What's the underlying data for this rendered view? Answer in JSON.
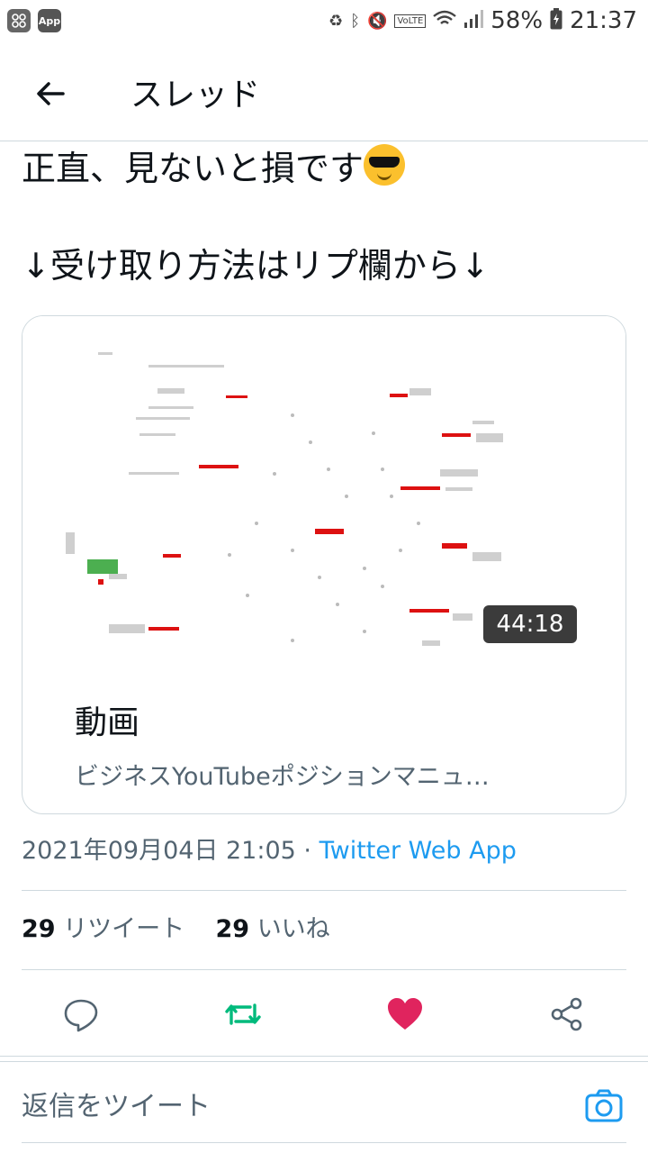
{
  "status_bar": {
    "app_icon_label": "App",
    "battery": "58%",
    "time": "21:37",
    "network": "VoLTE"
  },
  "header": {
    "title": "スレッド"
  },
  "tweet": {
    "line1": "正直、見ないと損です",
    "line2": "↓受け取り方法はリプ欄から↓"
  },
  "card": {
    "duration": "44:18",
    "title": "動画",
    "description": "ビジネスYouTubeポジションマニュ…"
  },
  "meta": {
    "datetime": "2021年09月04日 21:05",
    "separator": "·",
    "via": "Twitter Web App"
  },
  "stats": {
    "retweets_count": "29",
    "retweets_label": "リツイート",
    "likes_count": "29",
    "likes_label": "いいね"
  },
  "reply": {
    "placeholder": "返信をツイート"
  },
  "colors": {
    "accent": "#1d9bf0",
    "retweet": "#00ba7c",
    "like": "#f91880",
    "text": "#0f1419",
    "secondary": "#536471"
  }
}
